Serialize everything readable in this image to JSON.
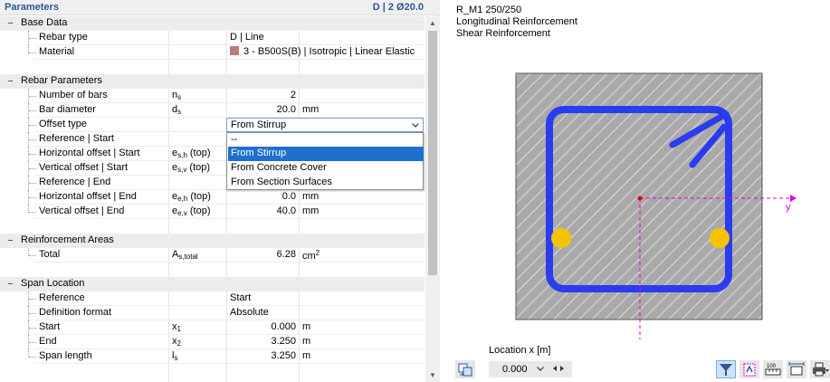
{
  "panel": {
    "title": "Parameters",
    "summary": "D | 2 Ø20.0"
  },
  "sections": {
    "base": {
      "title": "Base Data",
      "rebar_type_label": "Rebar type",
      "rebar_type_value": "D | Line",
      "material_label": "Material",
      "material_value": "3 - B500S(B) | Isotropic | Linear Elastic",
      "material_color": "#b97a78"
    },
    "rebar": {
      "title": "Rebar Parameters",
      "n_label": "Number of bars",
      "n_sym": "n",
      "n_sub": "s",
      "n_value": "2",
      "d_label": "Bar diameter",
      "d_sym": "d",
      "d_sub": "s",
      "d_value": "20.0",
      "d_unit": "mm",
      "offset_label": "Offset type",
      "offset_value": "From Stirrup",
      "ref_start_label": "Reference | Start",
      "hstart_label": "Horizontal offset | Start",
      "hstart_sym": "e",
      "hstart_sub": "s,h",
      "hstart_pos": "(top)",
      "vstart_label": "Vertical offset | Start",
      "vstart_sym": "e",
      "vstart_sub": "s,v",
      "vstart_pos": "(top)",
      "ref_end_label": "Reference | End",
      "hend_label": "Horizontal offset | End",
      "hend_sym": "e",
      "hend_sub": "e,h",
      "hend_pos": "(top)",
      "hend_value": "0.0",
      "hend_unit": "mm",
      "vend_label": "Vertical offset | End",
      "vend_sym": "e",
      "vend_sub": "e,v",
      "vend_pos": "(top)",
      "vend_value": "40.0",
      "vend_unit": "mm"
    },
    "areas": {
      "title": "Reinforcement Areas",
      "total_label": "Total",
      "total_sym": "A",
      "total_sub": "s,total",
      "total_value": "6.28",
      "total_unit": "cm",
      "total_unit_sup": "2"
    },
    "span": {
      "title": "Span Location",
      "ref_label": "Reference",
      "ref_value": "Start",
      "def_label": "Definition format",
      "def_value": "Absolute",
      "start_label": "Start",
      "start_sym": "x",
      "start_sub": "1",
      "start_value": "0.000",
      "start_unit": "m",
      "end_label": "End",
      "end_sym": "x",
      "end_sub": "2",
      "end_value": "3.250",
      "end_unit": "m",
      "len_label": "Span length",
      "len_sym": "l",
      "len_sub": "s",
      "len_value": "3.250",
      "len_unit": "m"
    }
  },
  "dropdown": {
    "options": [
      "--",
      "From Stirrup",
      "From Concrete Cover",
      "From Section Surfaces"
    ],
    "selected_index": 1,
    "highlight_color": "#1e6fce"
  },
  "preview": {
    "section_name": "R_M1 250/250",
    "line2": "Longitudinal Reinforcement",
    "line3": "Shear Reinforcement",
    "axis_y_label": "y",
    "stirrup_color": "#2b3bef",
    "bar_color": "#f5c400",
    "axis_color": "#e000e0",
    "location_label": "Location x [m]",
    "location_value": "0.000"
  },
  "toolbar": {
    "icons": [
      "sync-view-icon",
      "filter-icon",
      "section-values-icon",
      "scale-icon",
      "dimension-icon",
      "print-icon"
    ]
  }
}
